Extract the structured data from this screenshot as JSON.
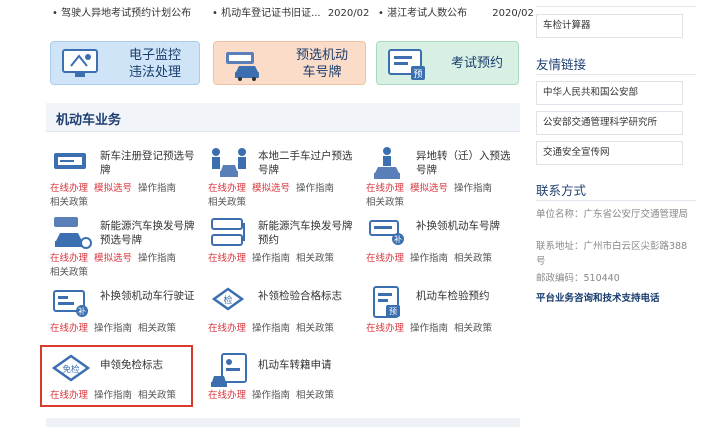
{
  "news": [
    {
      "text": "• 驾驶人异地考试预约计划公布",
      "date": ""
    },
    {
      "text": "• 机动车登记证书旧证...",
      "date": "2020/02"
    },
    {
      "text": "• 湛江考试人数公布",
      "date": "2020/02"
    }
  ],
  "banners": [
    {
      "line1": "电子监控",
      "line2": "违法处理"
    },
    {
      "line1": "预选机动",
      "line2": "车号牌"
    },
    {
      "line1": "考试预约",
      "line2": ""
    }
  ],
  "section_title": "机动车业务",
  "services": [
    {
      "title": "新车注册登记预选号牌",
      "links": [
        "在线办理",
        "模拟选号",
        "操作指南",
        "相关政策"
      ]
    },
    {
      "title": "本地二手车过户预选号牌",
      "links": [
        "在线办理",
        "模拟选号",
        "操作指南",
        "相关政策"
      ]
    },
    {
      "title": "异地转（迁）入预选号牌",
      "links": [
        "在线办理",
        "模拟选号",
        "操作指南",
        "相关政策"
      ]
    },
    {
      "title": "新能源汽车换发号牌预选号牌",
      "links": [
        "在线办理",
        "模拟选号",
        "操作指南",
        "相关政策"
      ]
    },
    {
      "title": "新能源汽车换发号牌预约",
      "links": [
        "在线办理",
        "操作指南",
        "相关政策"
      ]
    },
    {
      "title": "补换领机动车号牌",
      "links": [
        "在线办理",
        "操作指南",
        "相关政策"
      ]
    },
    {
      "title": "补换领机动车行驶证",
      "links": [
        "在线办理",
        "操作指南",
        "相关政策"
      ]
    },
    {
      "title": "补领检验合格标志",
      "links": [
        "在线办理",
        "操作指南",
        "相关政策"
      ]
    },
    {
      "title": "机动车检验预约",
      "links": [
        "在线办理",
        "操作指南",
        "相关政策"
      ]
    },
    {
      "title": "申领免检标志",
      "links": [
        "在线办理",
        "操作指南",
        "相关政策"
      ]
    },
    {
      "title": "机动车转籍申请",
      "links": [
        "在线办理",
        "操作指南",
        "相关政策"
      ]
    }
  ],
  "icon_texts": {
    "jian": "检",
    "mianjian": "免检",
    "bu": "补",
    "yu": "预"
  },
  "sidebar": {
    "calc": "车检计算器",
    "friend_title": "友情链接",
    "friend_links": [
      "中华人民共和国公安部",
      "公安部交通管理科学研究所",
      "交通安全宣传网"
    ],
    "contact_title": "联系方式",
    "contact_lines": [
      "单位名称：广东省公安厅交通管理局",
      "联系地址：广州市白云区尖彭路388号",
      "邮政编码：510440"
    ],
    "service_line": "平台业务咨询和技术支持电话"
  },
  "colors": {
    "accent_red": "#d9363e",
    "navy": "#1f3f73",
    "highlight_border": "#d83a2e"
  }
}
